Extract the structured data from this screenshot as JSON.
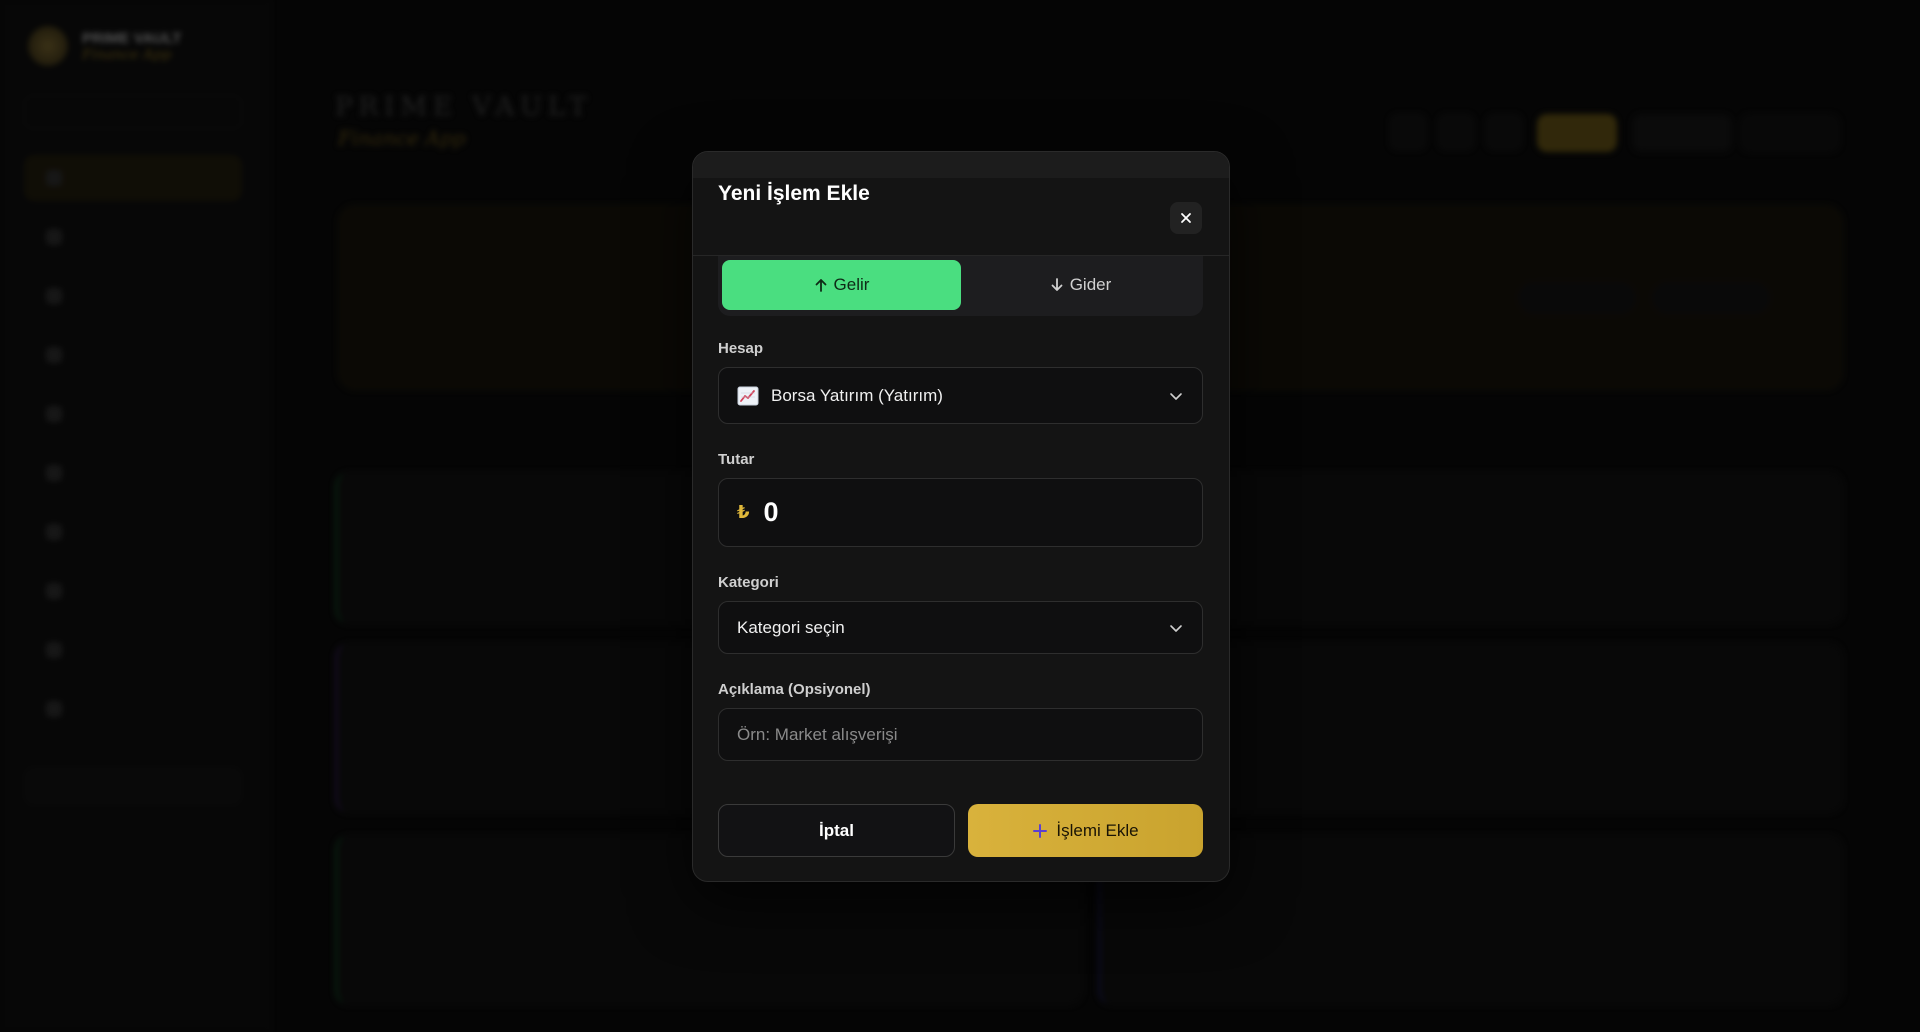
{
  "app": {
    "brand_name": "PRIME VAULT",
    "brand_sub": "Finance App"
  },
  "modal": {
    "title": "Yeni İşlem Ekle",
    "type_toggle": {
      "income_label": "Gelir",
      "expense_label": "Gider",
      "selected": "income"
    },
    "account": {
      "label": "Hesap",
      "value": "Borsa Yatırım (Yatırım)"
    },
    "amount": {
      "label": "Tutar",
      "currency_symbol": "₺",
      "value": "0"
    },
    "category": {
      "label": "Kategori",
      "value": "Kategori seçin"
    },
    "description": {
      "label": "Açıklama (Opsiyonel)",
      "placeholder": "Örn: Market alışverişi",
      "value": ""
    },
    "cancel_label": "İptal",
    "submit_label": "İşlemi Ekle"
  },
  "colors": {
    "income_green": "#4ade80",
    "gold_accent": "#d9b23c",
    "modal_bg": "#141414"
  }
}
